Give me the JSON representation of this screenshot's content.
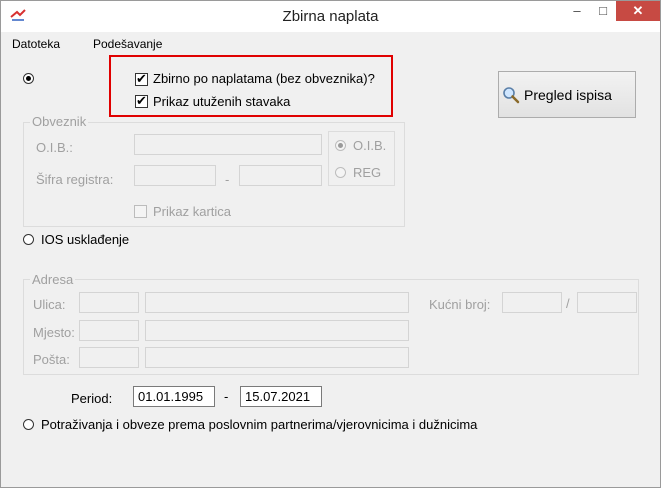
{
  "window": {
    "title": "Zbirna naplata"
  },
  "menu": {
    "file": "Datoteka",
    "settings": "Podešavanje"
  },
  "options": {
    "zbirno_label": "Zbirno po naplatama (bez obveznika)?",
    "utuzeni_label": "Prikaz utuženih stavaka",
    "pregled_button": "Pregled ispisa"
  },
  "obveznik": {
    "legend": "Obveznik",
    "oib_label": "O.I.B.:",
    "sifra_label": "Šifra registra:",
    "dash": "-",
    "radio_oib": "O.I.B.",
    "radio_reg": "REG",
    "kartica_label": "Prikaz kartica"
  },
  "ios": {
    "label": "IOS usklađenje"
  },
  "adresa": {
    "legend": "Adresa",
    "ulica_label": "Ulica:",
    "kucni_label": "Kućni broj:",
    "slash": "/",
    "mjesto_label": "Mjesto:",
    "posta_label": "Pošta:"
  },
  "period": {
    "label": "Period:",
    "from": "01.01.1995",
    "dash": "-",
    "to": "15.07.2021"
  },
  "potrazivanja": {
    "label": "Potraživanja i obveze prema poslovnim partnerima/vjerovnicima i dužnicima"
  },
  "colors": {
    "highlight": "#e00000",
    "close_button": "#c74a43"
  }
}
